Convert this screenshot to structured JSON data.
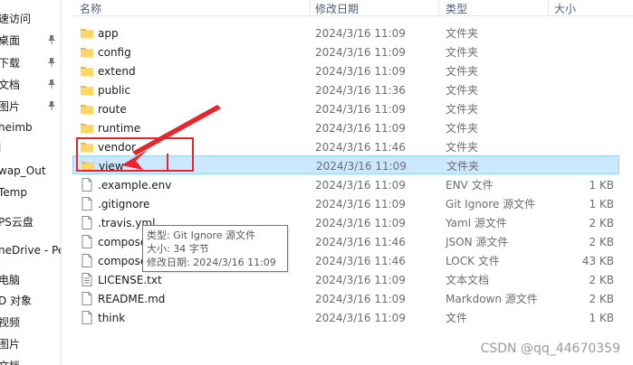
{
  "sidebar": {
    "items": [
      {
        "label": "速访问",
        "pinned": false
      },
      {
        "label": "桌面",
        "pinned": true
      },
      {
        "label": "下载",
        "pinned": true
      },
      {
        "label": "文档",
        "pinned": true
      },
      {
        "label": "图片",
        "pinned": true
      },
      {
        "label": "heimb",
        "pinned": false
      },
      {
        "label": "l",
        "pinned": false
      },
      {
        "label": "wap_Out",
        "pinned": false
      },
      {
        "label": "Temp",
        "pinned": false
      },
      {
        "label": "PS云盘",
        "pinned": false
      },
      {
        "label": "neDrive - Pe",
        "pinned": false
      },
      {
        "label": "电脑",
        "pinned": false
      },
      {
        "label": "D 对象",
        "pinned": false
      },
      {
        "label": "视频",
        "pinned": false
      },
      {
        "label": "图片",
        "pinned": false
      },
      {
        "label": "文档",
        "pinned": false
      }
    ]
  },
  "columns": {
    "name": "名称",
    "date": "修改日期",
    "type": "类型",
    "size": "大小"
  },
  "files": [
    {
      "name": "app",
      "date": "2024/3/16 11:09",
      "type": "文件夹",
      "size": "",
      "kind": "folder"
    },
    {
      "name": "config",
      "date": "2024/3/16 11:09",
      "type": "文件夹",
      "size": "",
      "kind": "folder"
    },
    {
      "name": "extend",
      "date": "2024/3/16 11:09",
      "type": "文件夹",
      "size": "",
      "kind": "folder"
    },
    {
      "name": "public",
      "date": "2024/3/16 11:36",
      "type": "文件夹",
      "size": "",
      "kind": "folder"
    },
    {
      "name": "route",
      "date": "2024/3/16 11:09",
      "type": "文件夹",
      "size": "",
      "kind": "folder"
    },
    {
      "name": "runtime",
      "date": "2024/3/16 11:09",
      "type": "文件夹",
      "size": "",
      "kind": "folder"
    },
    {
      "name": "vendor",
      "date": "2024/3/16 11:46",
      "type": "文件夹",
      "size": "",
      "kind": "folder"
    },
    {
      "name": "view",
      "date": "2024/3/16 11:09",
      "type": "文件夹",
      "size": "",
      "kind": "folder",
      "selected": true
    },
    {
      "name": ".example.env",
      "date": "2024/3/16 11:09",
      "type": "ENV 文件",
      "size": "1 KB",
      "kind": "file"
    },
    {
      "name": ".gitignore",
      "date": "2024/3/16 11:09",
      "type": "Git Ignore 源文件",
      "size": "1 KB",
      "kind": "file"
    },
    {
      "name": ".travis.yml",
      "date": "2024/3/16 11:09",
      "type": "Yaml 源文件",
      "size": "2 KB",
      "kind": "file"
    },
    {
      "name": "composer.json",
      "date": "2024/3/16 11:46",
      "type": "JSON 源文件",
      "size": "2 KB",
      "kind": "file"
    },
    {
      "name": "composer.lock",
      "date": "2024/3/16 11:46",
      "type": "LOCK 文件",
      "size": "43 KB",
      "kind": "file"
    },
    {
      "name": "LICENSE.txt",
      "date": "2024/3/16 11:09",
      "type": "文本文档",
      "size": "2 KB",
      "kind": "textfile"
    },
    {
      "name": "README.md",
      "date": "2024/3/16 11:09",
      "type": "Markdown 源文件",
      "size": "2 KB",
      "kind": "file"
    },
    {
      "name": "think",
      "date": "2024/3/16 11:09",
      "type": "文件",
      "size": "1 KB",
      "kind": "file"
    }
  ],
  "tooltip": {
    "type_line": "类型: Git Ignore 源文件",
    "size_line": "大小: 34 字节",
    "date_line": "修改日期: 2024/3/16 11:09"
  },
  "watermark": "CSDN @qq_44670359",
  "colors": {
    "annotation": "#e8252a",
    "selection_bg": "#cce8ff",
    "folder": "#ffd766"
  }
}
